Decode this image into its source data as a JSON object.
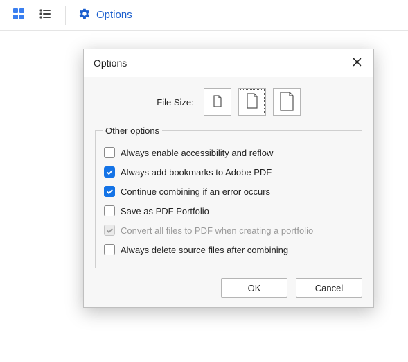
{
  "toolbar": {
    "options_label": "Options"
  },
  "dialog": {
    "title": "Options",
    "filesize_label": "File Size:",
    "group_label": "Other options",
    "options": [
      {
        "label": "Always enable accessibility and reflow",
        "checked": false,
        "disabled": false
      },
      {
        "label": "Always add bookmarks to Adobe PDF",
        "checked": true,
        "disabled": false
      },
      {
        "label": "Continue combining if an error occurs",
        "checked": true,
        "disabled": false
      },
      {
        "label": "Save as PDF Portfolio",
        "checked": false,
        "disabled": false
      },
      {
        "label": "Convert all files to PDF when creating a portfolio",
        "checked": true,
        "disabled": true
      },
      {
        "label": "Always delete source files after combining",
        "checked": false,
        "disabled": false
      }
    ],
    "ok_label": "OK",
    "cancel_label": "Cancel"
  }
}
